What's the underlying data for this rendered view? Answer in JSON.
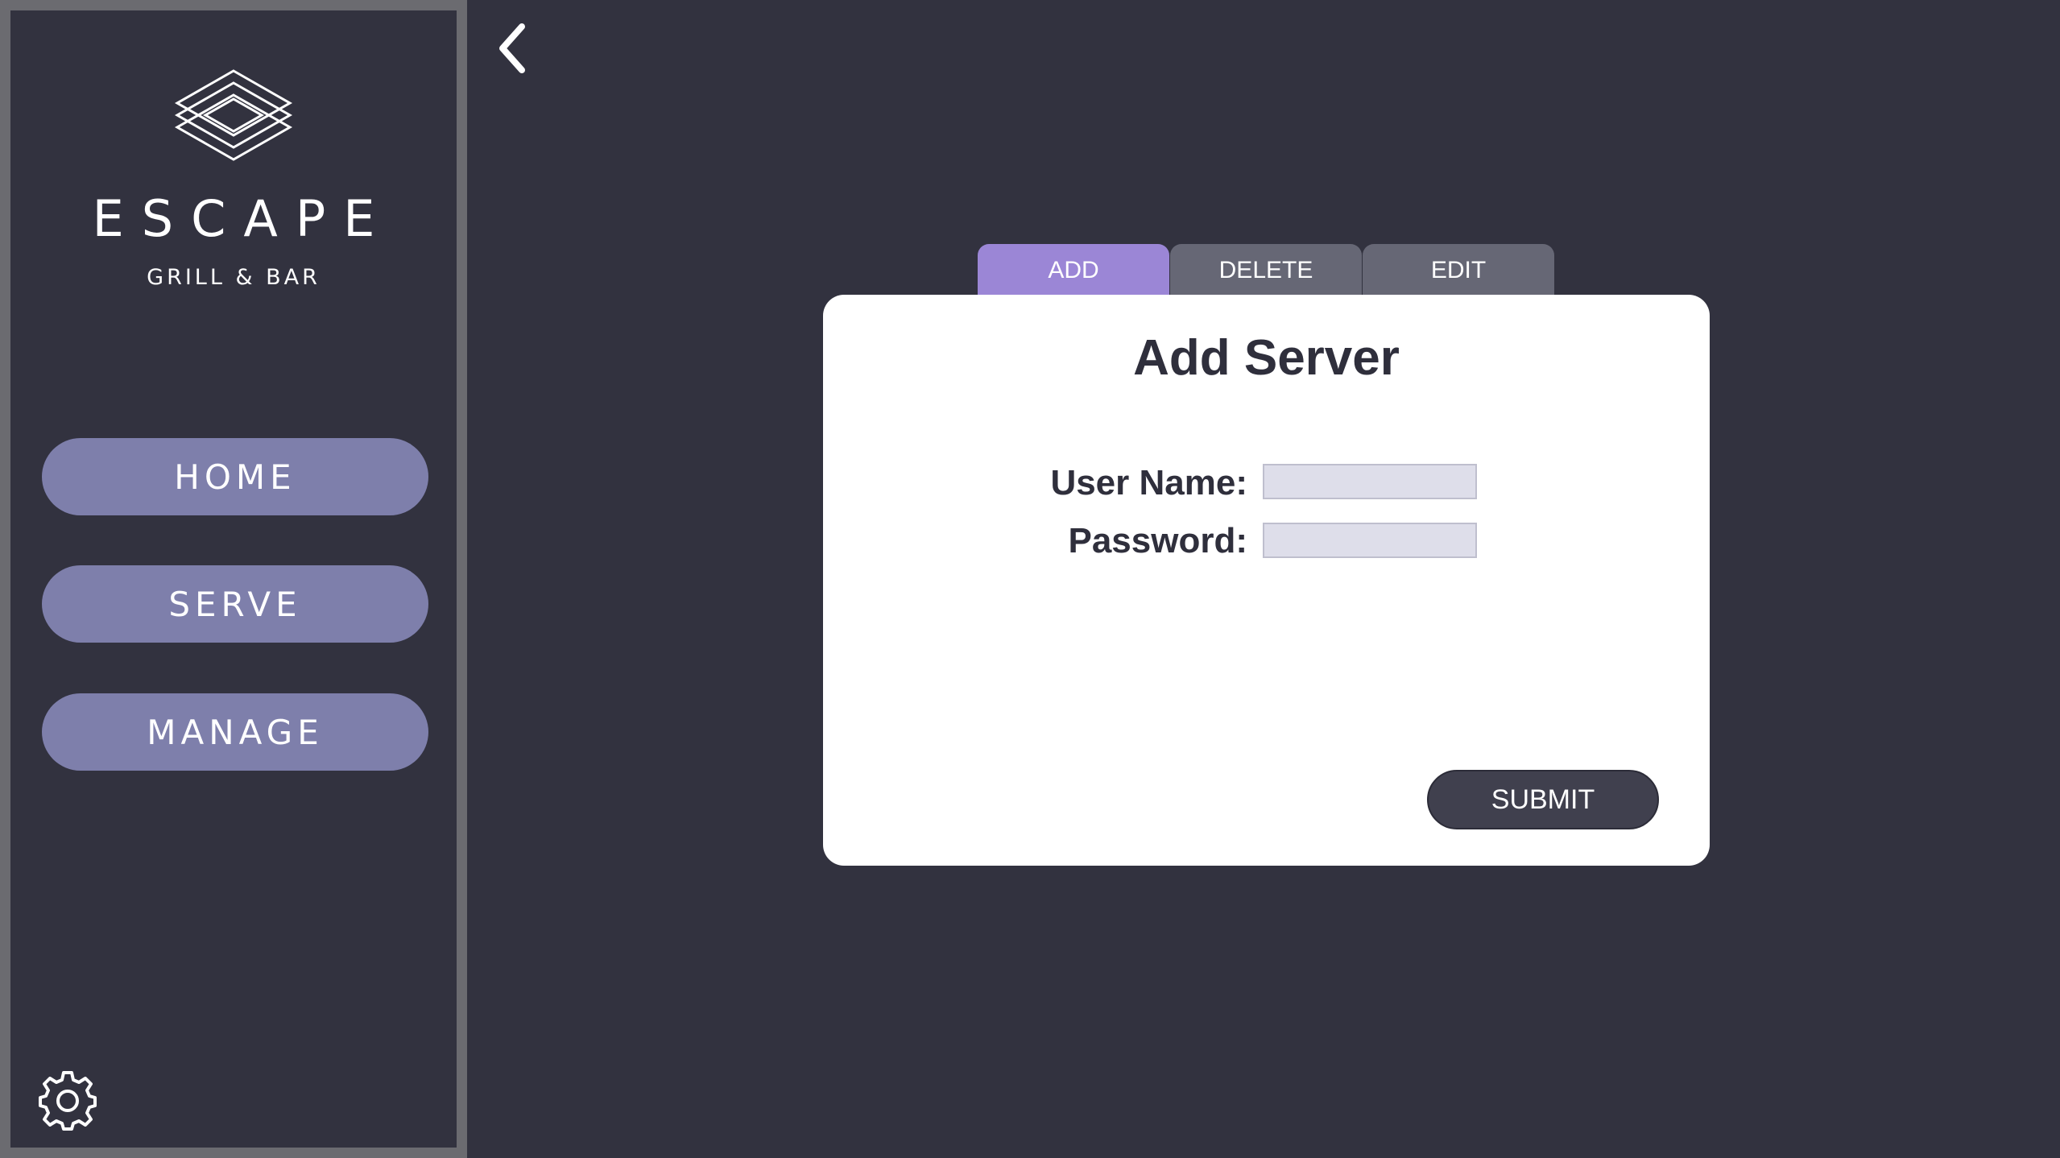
{
  "brand": {
    "name": "ESCAPE",
    "subtitle": "GRILL & BAR"
  },
  "sidebar": {
    "items": [
      {
        "label": "HOME"
      },
      {
        "label": "SERVE"
      },
      {
        "label": "MANAGE"
      }
    ],
    "settings_icon": "gear-icon"
  },
  "header": {
    "back_icon": "chevron-left-icon"
  },
  "tabs": [
    {
      "label": "ADD",
      "active": true
    },
    {
      "label": "DELETE",
      "active": false
    },
    {
      "label": "EDIT",
      "active": false
    }
  ],
  "form": {
    "title": "Add Server",
    "username_label": "User Name:",
    "username_value": "",
    "password_label": "Password:",
    "password_value": "",
    "submit_label": "SUBMIT"
  },
  "colors": {
    "background": "#32323f",
    "sidebar_border": "#6b6b70",
    "nav_button": "#7e7fab",
    "tab_active": "#9b86d6",
    "tab_inactive": "#666775",
    "card": "#ffffff",
    "input": "#dedeea",
    "submit": "#40404e"
  }
}
